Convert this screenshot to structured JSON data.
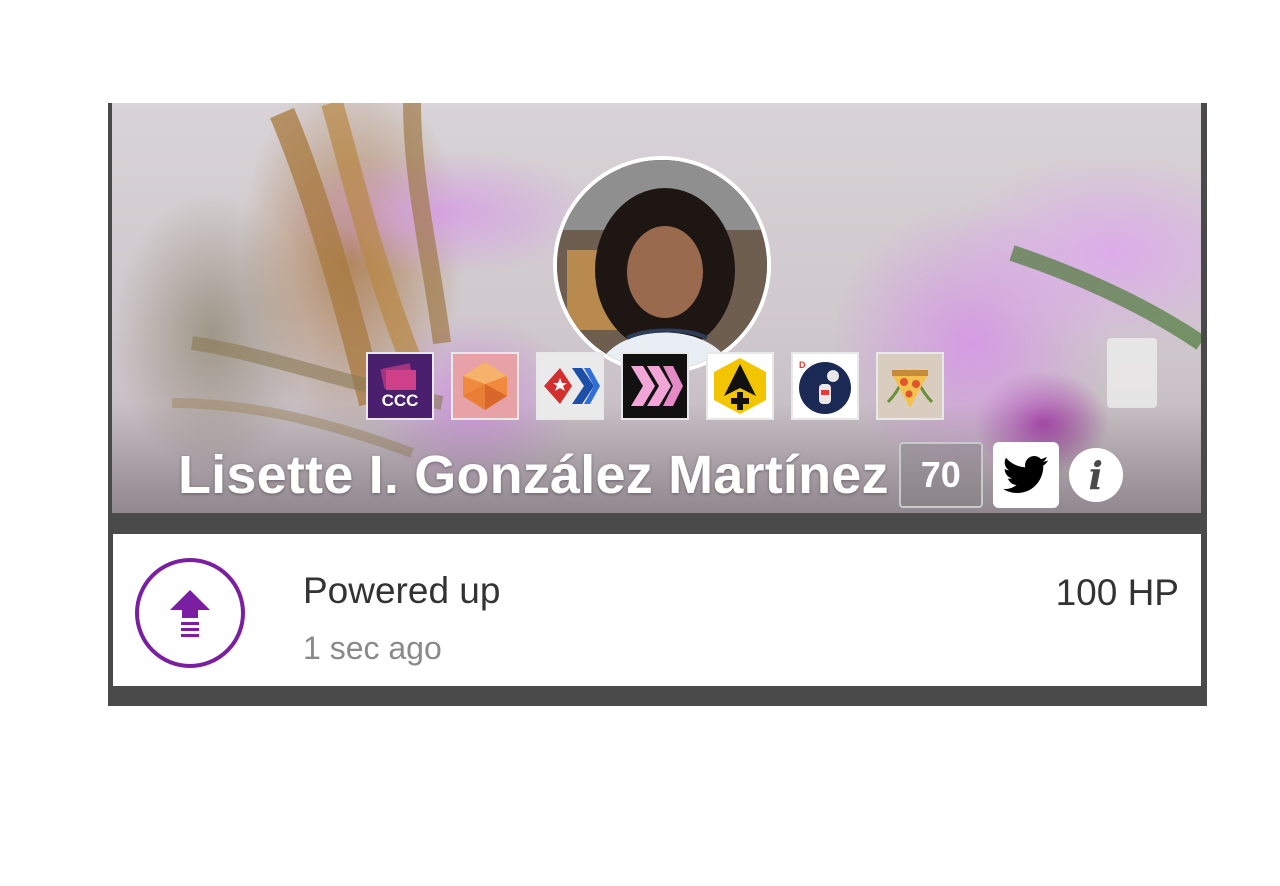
{
  "profile": {
    "name": "Lisette I. González Martínez",
    "reputation": "70",
    "info_glyph": "i"
  },
  "badges": [
    {
      "name": "ccc-badge",
      "label": "CCC",
      "bg": "#4a1f6e",
      "fg": "#ffffff"
    },
    {
      "name": "gem-badge",
      "label": "",
      "bg": "#e9a0a0",
      "fg": "#f08a3c"
    },
    {
      "name": "star-chevron-badge",
      "label": "",
      "bg": "#eaeaea",
      "fg": "#1e4fa8"
    },
    {
      "name": "hive-badge",
      "label": "",
      "bg": "#111111",
      "fg": "#f2a6d8"
    },
    {
      "name": "arrow-plus-badge",
      "label": "",
      "bg": "#f3c500",
      "fg": "#111111"
    },
    {
      "name": "discovery-badge",
      "label": "",
      "bg": "#1b2a55",
      "fg": "#e53935"
    },
    {
      "name": "pizza-badge",
      "label": "",
      "bg": "#d9cdbf",
      "fg": "#e0542e"
    }
  ],
  "activity": {
    "title": "Powered up",
    "time": "1 sec ago",
    "amount": "100 HP",
    "icon": "power-up-arrow-icon",
    "accent": "#7b1fa2"
  },
  "colors": {
    "frame": "#4a4a4a",
    "twitter": "#000000"
  }
}
